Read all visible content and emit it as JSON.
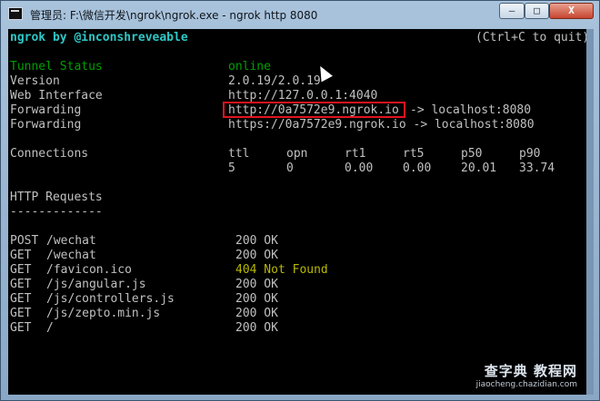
{
  "window": {
    "title": "管理员: F:\\微信开发\\ngrok\\ngrok.exe - ngrok  http 8080",
    "buttons": {
      "minimize": "—",
      "maximize": "□",
      "close": "X"
    }
  },
  "console": {
    "header": {
      "left": "ngrok by @inconshreveable",
      "right": "(Ctrl+C to quit)"
    },
    "status": {
      "tunnel_status_label": "Tunnel Status",
      "tunnel_status_value": "online",
      "version_label": "Version",
      "version_value": "2.0.19/2.0.19",
      "web_interface_label": "Web Interface",
      "web_interface_value": "http://127.0.0.1:4040",
      "forwarding_label": "Forwarding",
      "forwarding_http_url": "http://0a7572e9.ngrok.io",
      "forwarding_http_target": "-> localhost:8080",
      "forwarding_https": "https://0a7572e9.ngrok.io -> localhost:8080"
    },
    "connections": {
      "label": "Connections",
      "headers": [
        "ttl",
        "opn",
        "rt1",
        "rt5",
        "p50",
        "p90"
      ],
      "values": [
        "5",
        "0",
        "0.00",
        "0.00",
        "20.01",
        "33.74"
      ]
    },
    "http_requests": {
      "title": "HTTP Requests",
      "underline": "-------------",
      "rows": [
        {
          "method": "POST",
          "path": "/wechat",
          "status": "200 OK",
          "error": false
        },
        {
          "method": "GET",
          "path": "/wechat",
          "status": "200 OK",
          "error": false
        },
        {
          "method": "GET",
          "path": "/favicon.ico",
          "status": "404 Not Found",
          "error": true
        },
        {
          "method": "GET",
          "path": "/js/angular.js",
          "status": "200 OK",
          "error": false
        },
        {
          "method": "GET",
          "path": "/js/controllers.js",
          "status": "200 OK",
          "error": false
        },
        {
          "method": "GET",
          "path": "/js/zepto.min.js",
          "status": "200 OK",
          "error": false
        },
        {
          "method": "GET",
          "path": "/",
          "status": "200 OK",
          "error": false
        }
      ]
    }
  },
  "watermark": {
    "main": "查字典 教程网",
    "url": "jiaocheng.chazidian.com"
  },
  "colors": {
    "header": "#2ec7c7",
    "status_online": "#00a000",
    "error_status": "#b8b800",
    "highlight_box": "#e0141e"
  }
}
